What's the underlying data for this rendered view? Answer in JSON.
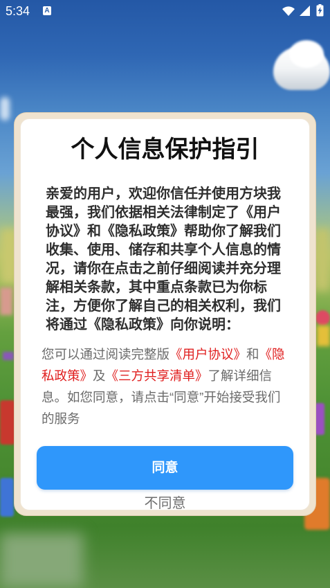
{
  "status_bar": {
    "time": "5:34",
    "notification_glyph": "A",
    "icons": {
      "notification": "a-notification-icon",
      "wifi": "wifi-icon",
      "signal": "signal-icon",
      "battery": "battery-charging-icon"
    }
  },
  "dialog": {
    "title": "个人信息保护指引",
    "intro_lines": [
      "亲爱的用户，欢迎你信任并使用方块我",
      "最强，我们依据相关法律制定了《用户",
      "协议》和《隐私政策》帮助你了解我们",
      "收集、使用、储存和共享个人信息的情",
      "况，请你在点击之前仔细阅读并充分理",
      "解相关条款，其中重点条款已为你标",
      "注，方便你了解自己的相关权利，我们",
      "将通过《隐私政策》向你说明："
    ],
    "notice_lines": [
      [
        {
          "text": "您可以通过阅读完整版",
          "is_link": false
        },
        {
          "text": "《用户协议》",
          "is_link": true
        },
        {
          "text": "和",
          "is_link": false
        },
        {
          "text": "《隐",
          "is_link": true
        }
      ],
      [
        {
          "text": "私政策》",
          "is_link": true
        },
        {
          "text": "及",
          "is_link": false
        },
        {
          "text": "《三方共享清单》",
          "is_link": true
        },
        {
          "text": "了解详细信",
          "is_link": false
        }
      ],
      [
        {
          "text": "息。如您同意，请点击“同意”开始接受我们",
          "is_link": false
        }
      ],
      [
        {
          "text": "的服务",
          "is_link": false
        }
      ]
    ],
    "agree_label": "同意",
    "disagree_label": "不同意"
  },
  "colors": {
    "accent": "#2f97fb",
    "link": "#e01f1f",
    "frame": "#efe3cf"
  }
}
